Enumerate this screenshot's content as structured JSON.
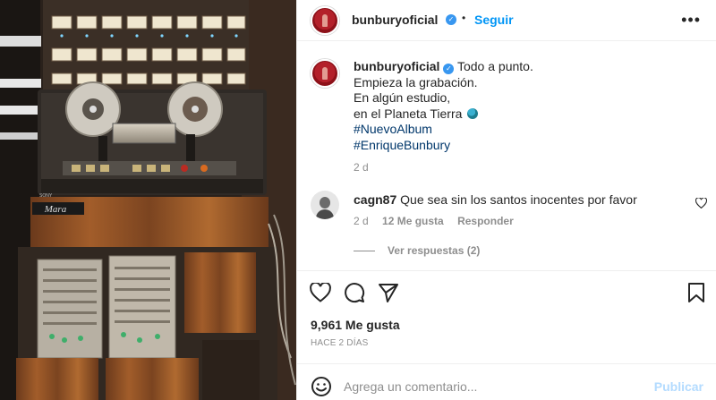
{
  "header": {
    "username": "bunburyoficial",
    "follow_label": "Seguir",
    "separator": "•"
  },
  "post": {
    "caption_user": "bunburyoficial",
    "caption_lines": [
      "Todo a punto.",
      "Empieza la grabación.",
      "En algún estudio,",
      "en el Planeta Tierra"
    ],
    "hashtags": [
      "#NuevoAlbum",
      "#EnriqueBunbury"
    ],
    "time_ago": "2 d"
  },
  "comment": {
    "user": "cagn87",
    "text": "Que sea sin los santos inocentes por favor",
    "time_ago": "2 d",
    "likes": "12 Me gusta",
    "reply_label": "Responder",
    "view_replies": "Ver respuestas (2)"
  },
  "actions": {
    "likes_count": "9,961 Me gusta",
    "posted_ago": "HACE 2 DÍAS"
  },
  "composer": {
    "placeholder": "Agrega un comentario...",
    "publish_label": "Publicar"
  },
  "photo": {
    "brand_plate": "Mara",
    "small_brand": "SONY"
  },
  "colors": {
    "accent": "#0095f6",
    "hashtag": "#00376b",
    "muted": "#8e8e8e",
    "publish_disabled": "#b3dbff",
    "verified": "#3897f0"
  }
}
